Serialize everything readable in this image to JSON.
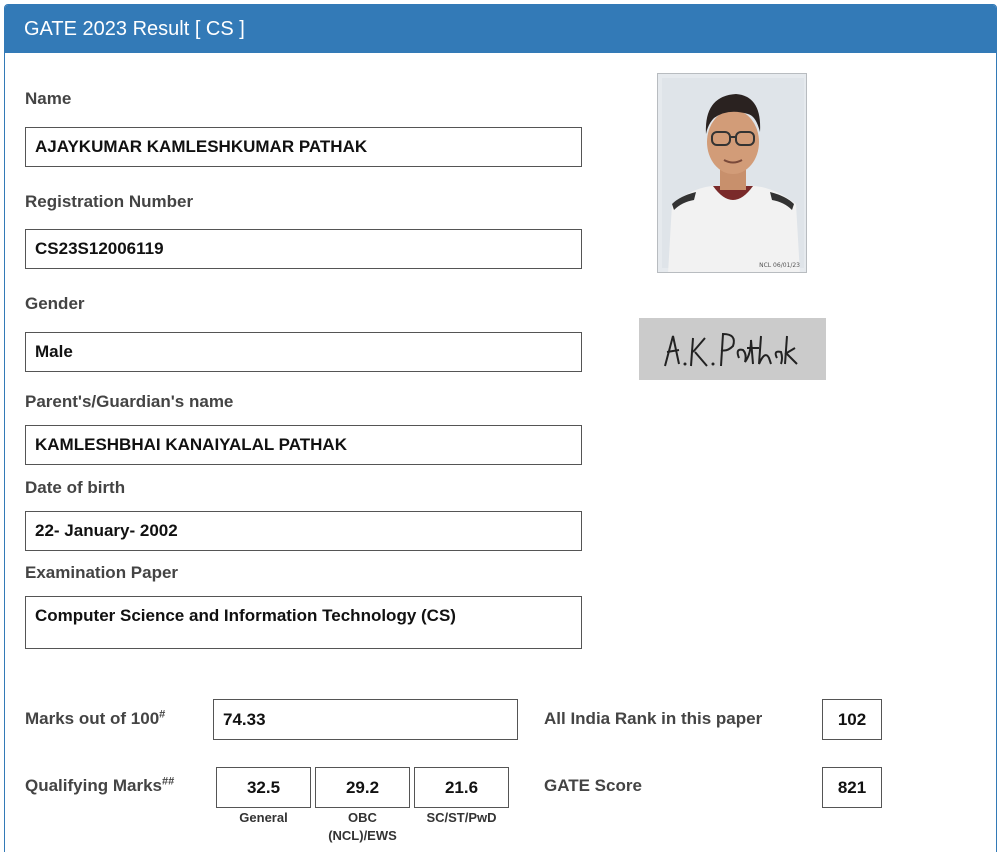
{
  "header": {
    "title": "GATE 2023 Result [ CS ]"
  },
  "fields": {
    "name": {
      "label": "Name",
      "value": "AJAYKUMAR KAMLESHKUMAR PATHAK"
    },
    "registration": {
      "label": "Registration Number",
      "value": "CS23S12006119"
    },
    "gender": {
      "label": "Gender",
      "value": "Male"
    },
    "guardian": {
      "label": "Parent's/Guardian's name",
      "value": "KAMLESHBHAI KANAIYALAL PATHAK"
    },
    "dob": {
      "label": "Date of birth",
      "value": "22- January- 2002"
    },
    "paper": {
      "label": "Examination Paper",
      "value": "Computer Science and Information Technology (CS)"
    }
  },
  "photo": {
    "stamp_text": "NCL 06/01/23"
  },
  "signature": {
    "text": "A.K. Pathak"
  },
  "scores": {
    "marks_label": "Marks out of 100",
    "marks_sup": "#",
    "marks_value": "74.33",
    "rank_label": "All India Rank in this paper",
    "rank_value": "102",
    "qualifying_label": "Qualifying Marks",
    "qualifying_sup": "##",
    "qualifying": [
      {
        "value": "32.5",
        "caption": "General"
      },
      {
        "value": "29.2",
        "caption_line1": "OBC",
        "caption_line2": "(NCL)/EWS"
      },
      {
        "value": "21.6",
        "caption": "SC/ST/PwD"
      }
    ],
    "gate_score_label": "GATE Score",
    "gate_score_value": "821"
  },
  "colors": {
    "header_bg": "#337ab7",
    "header_text": "#ffffff"
  }
}
